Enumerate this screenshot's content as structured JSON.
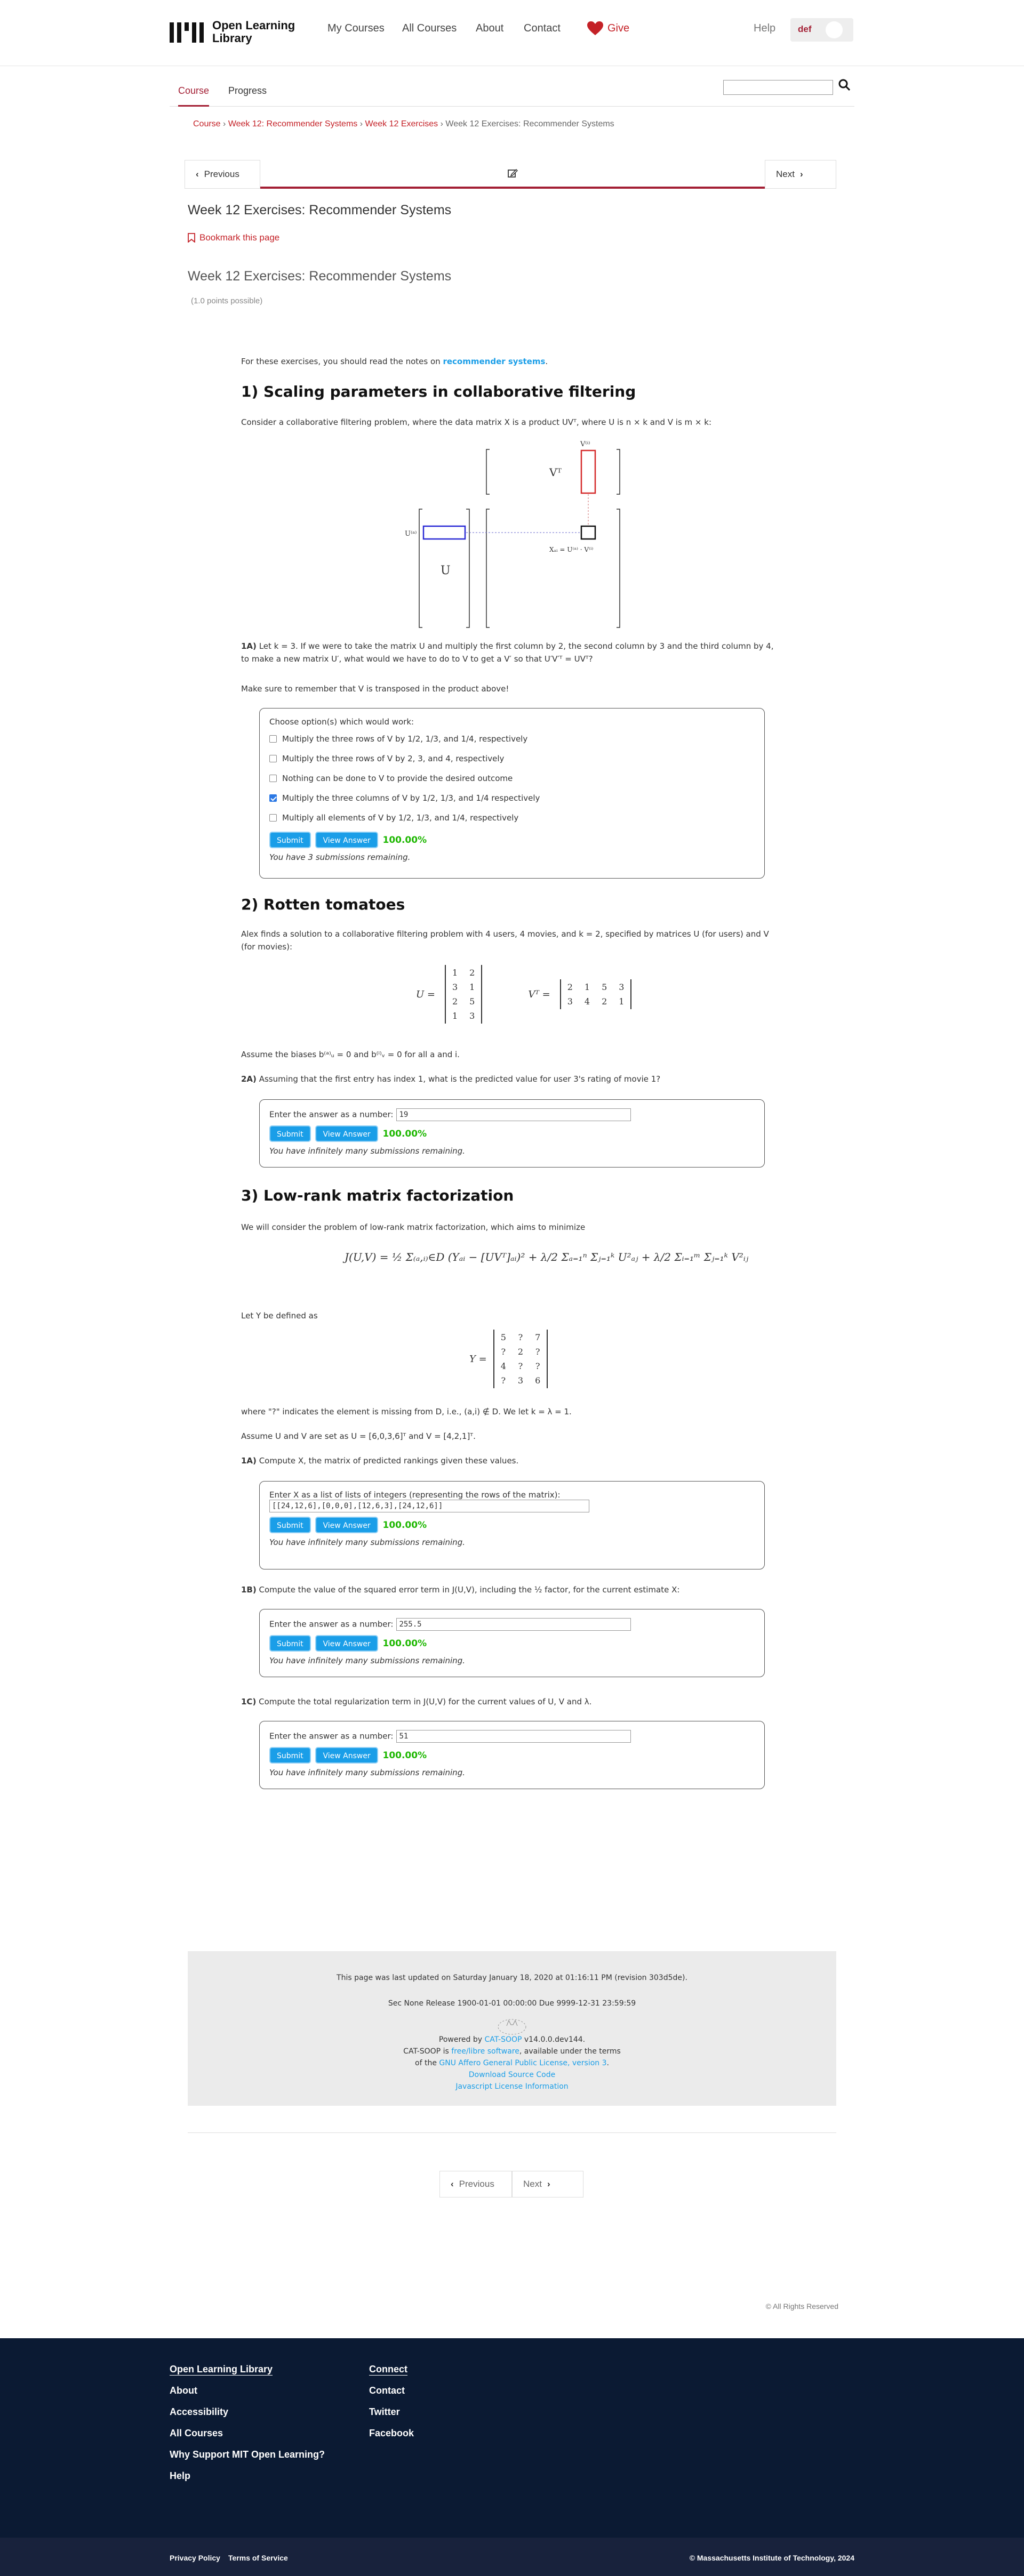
{
  "header": {
    "logo_line1": "Open Learning",
    "logo_line2": "Library",
    "nav": [
      "My Courses",
      "All Courses",
      "About",
      "Contact"
    ],
    "give": "Give",
    "help": "Help",
    "username": "def"
  },
  "tabs": {
    "course": "Course",
    "progress": "Progress"
  },
  "breadcrumb": {
    "course": "Course",
    "week": "Week 12: Recommender Systems",
    "sub": "Week 12 Exercises",
    "current": "Week 12 Exercises: Recommender Systems"
  },
  "sequence": {
    "previous": "Previous",
    "next": "Next"
  },
  "unit_title": "Week 12 Exercises: Recommender Systems",
  "bookmark": "Bookmark this page",
  "problem": {
    "title": "Week 12 Exercises: Recommender Systems",
    "points": "(1.0 points possible)"
  },
  "intro": {
    "before": "For these exercises, you should read the notes on ",
    "link": "recommender systems",
    "after": "."
  },
  "s1": {
    "heading": "1) Scaling parameters in collaborative filtering",
    "text": "Consider a collaborative filtering problem, where the data matrix X is a product UVᵀ, where U is n × k and V is m × k:",
    "diagram": {
      "vt": "Vᵀ",
      "vi": "V⁽ⁱ⁾",
      "ua": "U⁽ᵃ⁾",
      "u": "U",
      "x": "Xₐᵢ = U⁽ᵃ⁾ · V⁽ⁱ⁾"
    },
    "q_label": "1A)",
    "q_text": "Let k = 3. If we were to take the matrix U and multiply the first column by 2, the second column by 3 and the third column by 4, to make a new matrix U′, what would we have to do to V to get a V′ so that U′V′ᵀ = UVᵀ?",
    "note": "Make sure to remember that V is transposed in the product above!",
    "box_prompt": "Choose option(s) which would work:",
    "options": [
      {
        "label": "Multiply the three rows of V by 1/2, 1/3, and 1/4, respectively",
        "checked": false
      },
      {
        "label": "Multiply the three rows of V by 2, 3, and 4, respectively",
        "checked": false
      },
      {
        "label": "Nothing can be done to V to provide the desired outcome",
        "checked": false
      },
      {
        "label": "Multiply the three columns of V by 1/2, 1/3, and 1/4 respectively",
        "checked": true
      },
      {
        "label": "Multiply all elements of V by 1/2, 1/3, and 1/4, respectively",
        "checked": false
      }
    ],
    "submit": "Submit",
    "view": "View Answer",
    "score": "100.00%",
    "remaining": "You have 3 submissions remaining."
  },
  "s2": {
    "heading": "2) Rotten tomatoes",
    "text": "Alex finds a solution to a collaborative filtering problem with 4 users, 4 movies, and k = 2, specified by matrices U (for users) and V (for movies):",
    "U": [
      [
        "1",
        "2"
      ],
      [
        "3",
        "1"
      ],
      [
        "2",
        "5"
      ],
      [
        "1",
        "3"
      ]
    ],
    "VT": [
      [
        "2",
        "1",
        "5",
        "3"
      ],
      [
        "3",
        "4",
        "2",
        "1"
      ]
    ],
    "u_label": "U =",
    "vt_label": "Vᵀ =",
    "biases": "Assume the biases b⁽ᵃ⁾ᵤ = 0 and b⁽ⁱ⁾ᵥ = 0 for all a and i.",
    "q_label": "2A)",
    "q_text": "Assuming that the first entry has index 1, what is the predicted value for user 3's rating of movie 1?",
    "prompt": "Enter the answer as a number:",
    "answer": "19",
    "submit": "Submit",
    "view": "View Answer",
    "score": "100.00%",
    "remaining": "You have infinitely many submissions remaining."
  },
  "s3": {
    "heading": "3) Low-rank matrix factorization",
    "text": "We will consider the problem of low-rank matrix factorization, which aims to minimize",
    "objective": "J(U,V) = ½ Σ₍ₐ,ᵢ₎∈D (Yₐᵢ − [UVᵀ]ₐᵢ)² + λ/2 Σₐ₌₁ⁿ Σⱼ₌₁ᵏ U²ₐⱼ + λ/2 Σᵢ₌₁ᵐ Σⱼ₌₁ᵏ V²ᵢⱼ",
    "let_y": "Let Y be defined as",
    "Y": [
      [
        "5",
        "?",
        "7"
      ],
      [
        "?",
        "2",
        "?"
      ],
      [
        "4",
        "?",
        "?"
      ],
      [
        "?",
        "3",
        "6"
      ]
    ],
    "y_label": "Y =",
    "where": "where \"?\" indicates the element is missing from D, i.e., (a,i) ∉ D. We let k = λ = 1.",
    "assume": "Assume U and V are set as U = [6,0,3,6]ᵀ and V = [4,2,1]ᵀ.",
    "q1_label": "1A)",
    "q1_text": "Compute X, the matrix of predicted rankings given these values.",
    "q1_prompt": "Enter X as a list of lists of integers (representing the rows of the matrix):",
    "q1_answer": "[[24,12,6],[0,0,0],[12,6,3],[24,12,6]]",
    "q2_label": "1B)",
    "q2_text": "Compute the value of the squared error term in J(U,V), including the ½ factor, for the current estimate X:",
    "q2_answer": "255.5",
    "q3_label": "1C)",
    "q3_text": "Compute the total regularization term in J(U,V) for the current values of U, V and λ.",
    "q3_answer": "51",
    "prompt": "Enter the answer as a number:",
    "submit": "Submit",
    "view": "View Answer",
    "score": "100.00%",
    "remaining": "You have infinitely many submissions remaining."
  },
  "catsoop": {
    "updated": "This page was last updated on Saturday January 18, 2020 at 01:16:11 PM (revision 303d5de).",
    "release": "Sec None Release 1900-01-01 00:00:00 Due 9999-12-31 23:59:59",
    "powered_pre": "Powered by ",
    "powered_link": "CAT-SOOP",
    "powered_post": " v14.0.0.dev144.",
    "license_pre": "CAT-SOOP is ",
    "license_link": "free/libre software",
    "license_post": ", available under the terms",
    "license2_pre": "of the ",
    "license2_link": "GNU Affero General Public License, version 3",
    "license2_post": ".",
    "download": "Download Source Code",
    "js": "Javascript License Information"
  },
  "pager": {
    "previous": "Previous",
    "next": "Next"
  },
  "copyright_small": "© All Rights Reserved",
  "footer": {
    "col1_head": "Open Learning Library",
    "col1": [
      "About",
      "Accessibility",
      "All Courses",
      "Why Support MIT Open Learning?",
      "Help"
    ],
    "col2_head": "Connect",
    "col2": [
      "Contact",
      "Twitter",
      "Facebook"
    ],
    "privacy": "Privacy Policy",
    "terms": "Terms of Service",
    "copyright": "© Massachusetts Institute of Technology, 2024"
  }
}
